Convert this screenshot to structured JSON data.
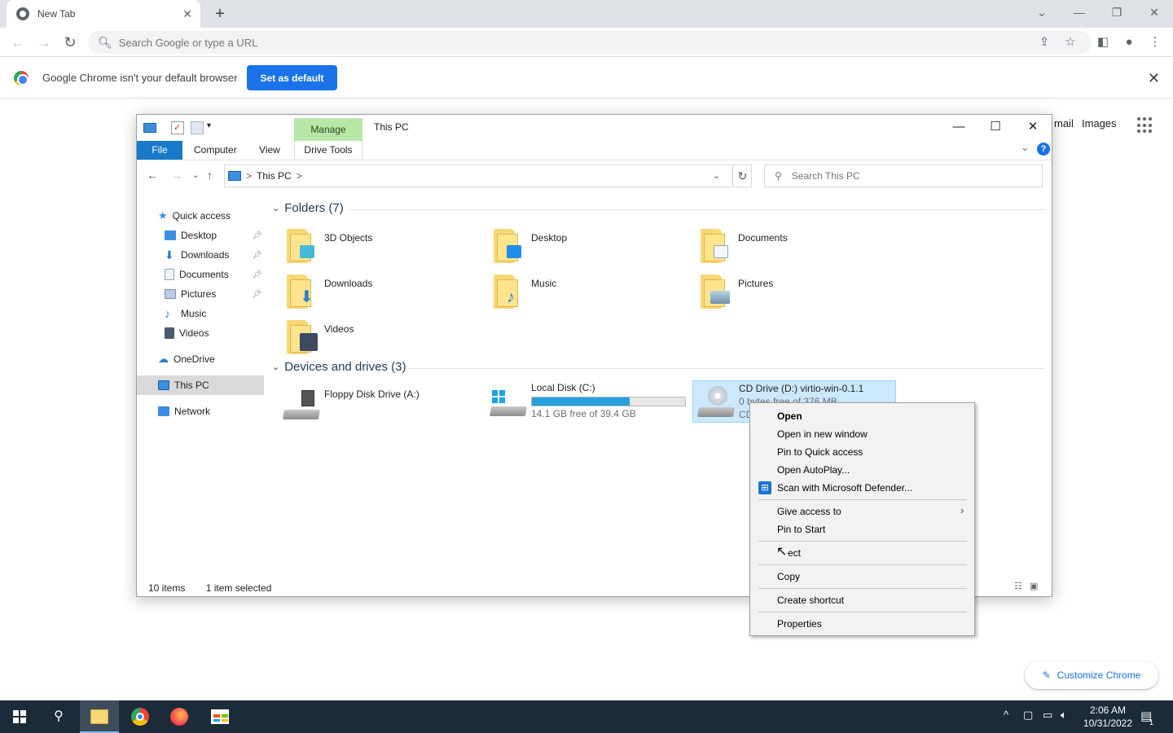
{
  "browser": {
    "tab_title": "New Tab",
    "tab_close": "✕",
    "new_tab": "+",
    "omnibox_placeholder": "Search Google or type a URL",
    "infobar_message": "Google Chrome isn't your default browser",
    "set_default_label": "Set as default",
    "ntp_gmail": "mail",
    "ntp_images": "Images",
    "customize_label": "Customize Chrome",
    "colors": {
      "accent": "#1a73e8",
      "tabstrip": "#dee1e6"
    }
  },
  "explorer": {
    "title": "This PC",
    "manage_label": "Manage",
    "ribbon_tabs": [
      "File",
      "Computer",
      "View",
      "Drive Tools"
    ],
    "address": {
      "location": "This PC",
      "separator": ">"
    },
    "search_placeholder": "Search This PC",
    "nav": [
      {
        "label": "Quick access",
        "icon": "star-icon"
      },
      {
        "label": "Desktop",
        "icon": "desktop-icon",
        "pinned": true
      },
      {
        "label": "Downloads",
        "icon": "download-icon",
        "pinned": true
      },
      {
        "label": "Documents",
        "icon": "documents-icon",
        "pinned": true
      },
      {
        "label": "Pictures",
        "icon": "pictures-icon",
        "pinned": true
      },
      {
        "label": "Music",
        "icon": "music-icon"
      },
      {
        "label": "Videos",
        "icon": "videos-icon"
      },
      {
        "label": "OneDrive",
        "icon": "cloud-icon"
      },
      {
        "label": "This PC",
        "icon": "pc-icon",
        "selected": true
      },
      {
        "label": "Network",
        "icon": "network-icon"
      }
    ],
    "folders_header": "Folders (7)",
    "folders": [
      "3D Objects",
      "Desktop",
      "Documents",
      "Downloads",
      "Music",
      "Pictures",
      "Videos"
    ],
    "drives_header": "Devices and drives (3)",
    "drives": [
      {
        "label": "Floppy Disk Drive (A:)"
      },
      {
        "label": "Local Disk (C:)",
        "free_text": "14.1 GB free of 39.4 GB",
        "used_fraction": 0.64
      },
      {
        "label": "CD Drive (D:) virtio-win-0.1.1",
        "free_text": "0 bytes free of 376 MB",
        "extra": "CD"
      }
    ],
    "status_items": "10 items",
    "status_selected": "1 item selected"
  },
  "context_menu": {
    "items": [
      "Open",
      "Open in new window",
      "Pin to Quick access",
      "Open AutoPlay...",
      "Scan with Microsoft Defender...",
      "Give access to",
      "Pin to Start",
      "ect",
      "Copy",
      "Create shortcut",
      "Properties"
    ]
  },
  "taskbar": {
    "time": "2:06 AM",
    "date": "10/31/2022",
    "notification_count": "1"
  }
}
